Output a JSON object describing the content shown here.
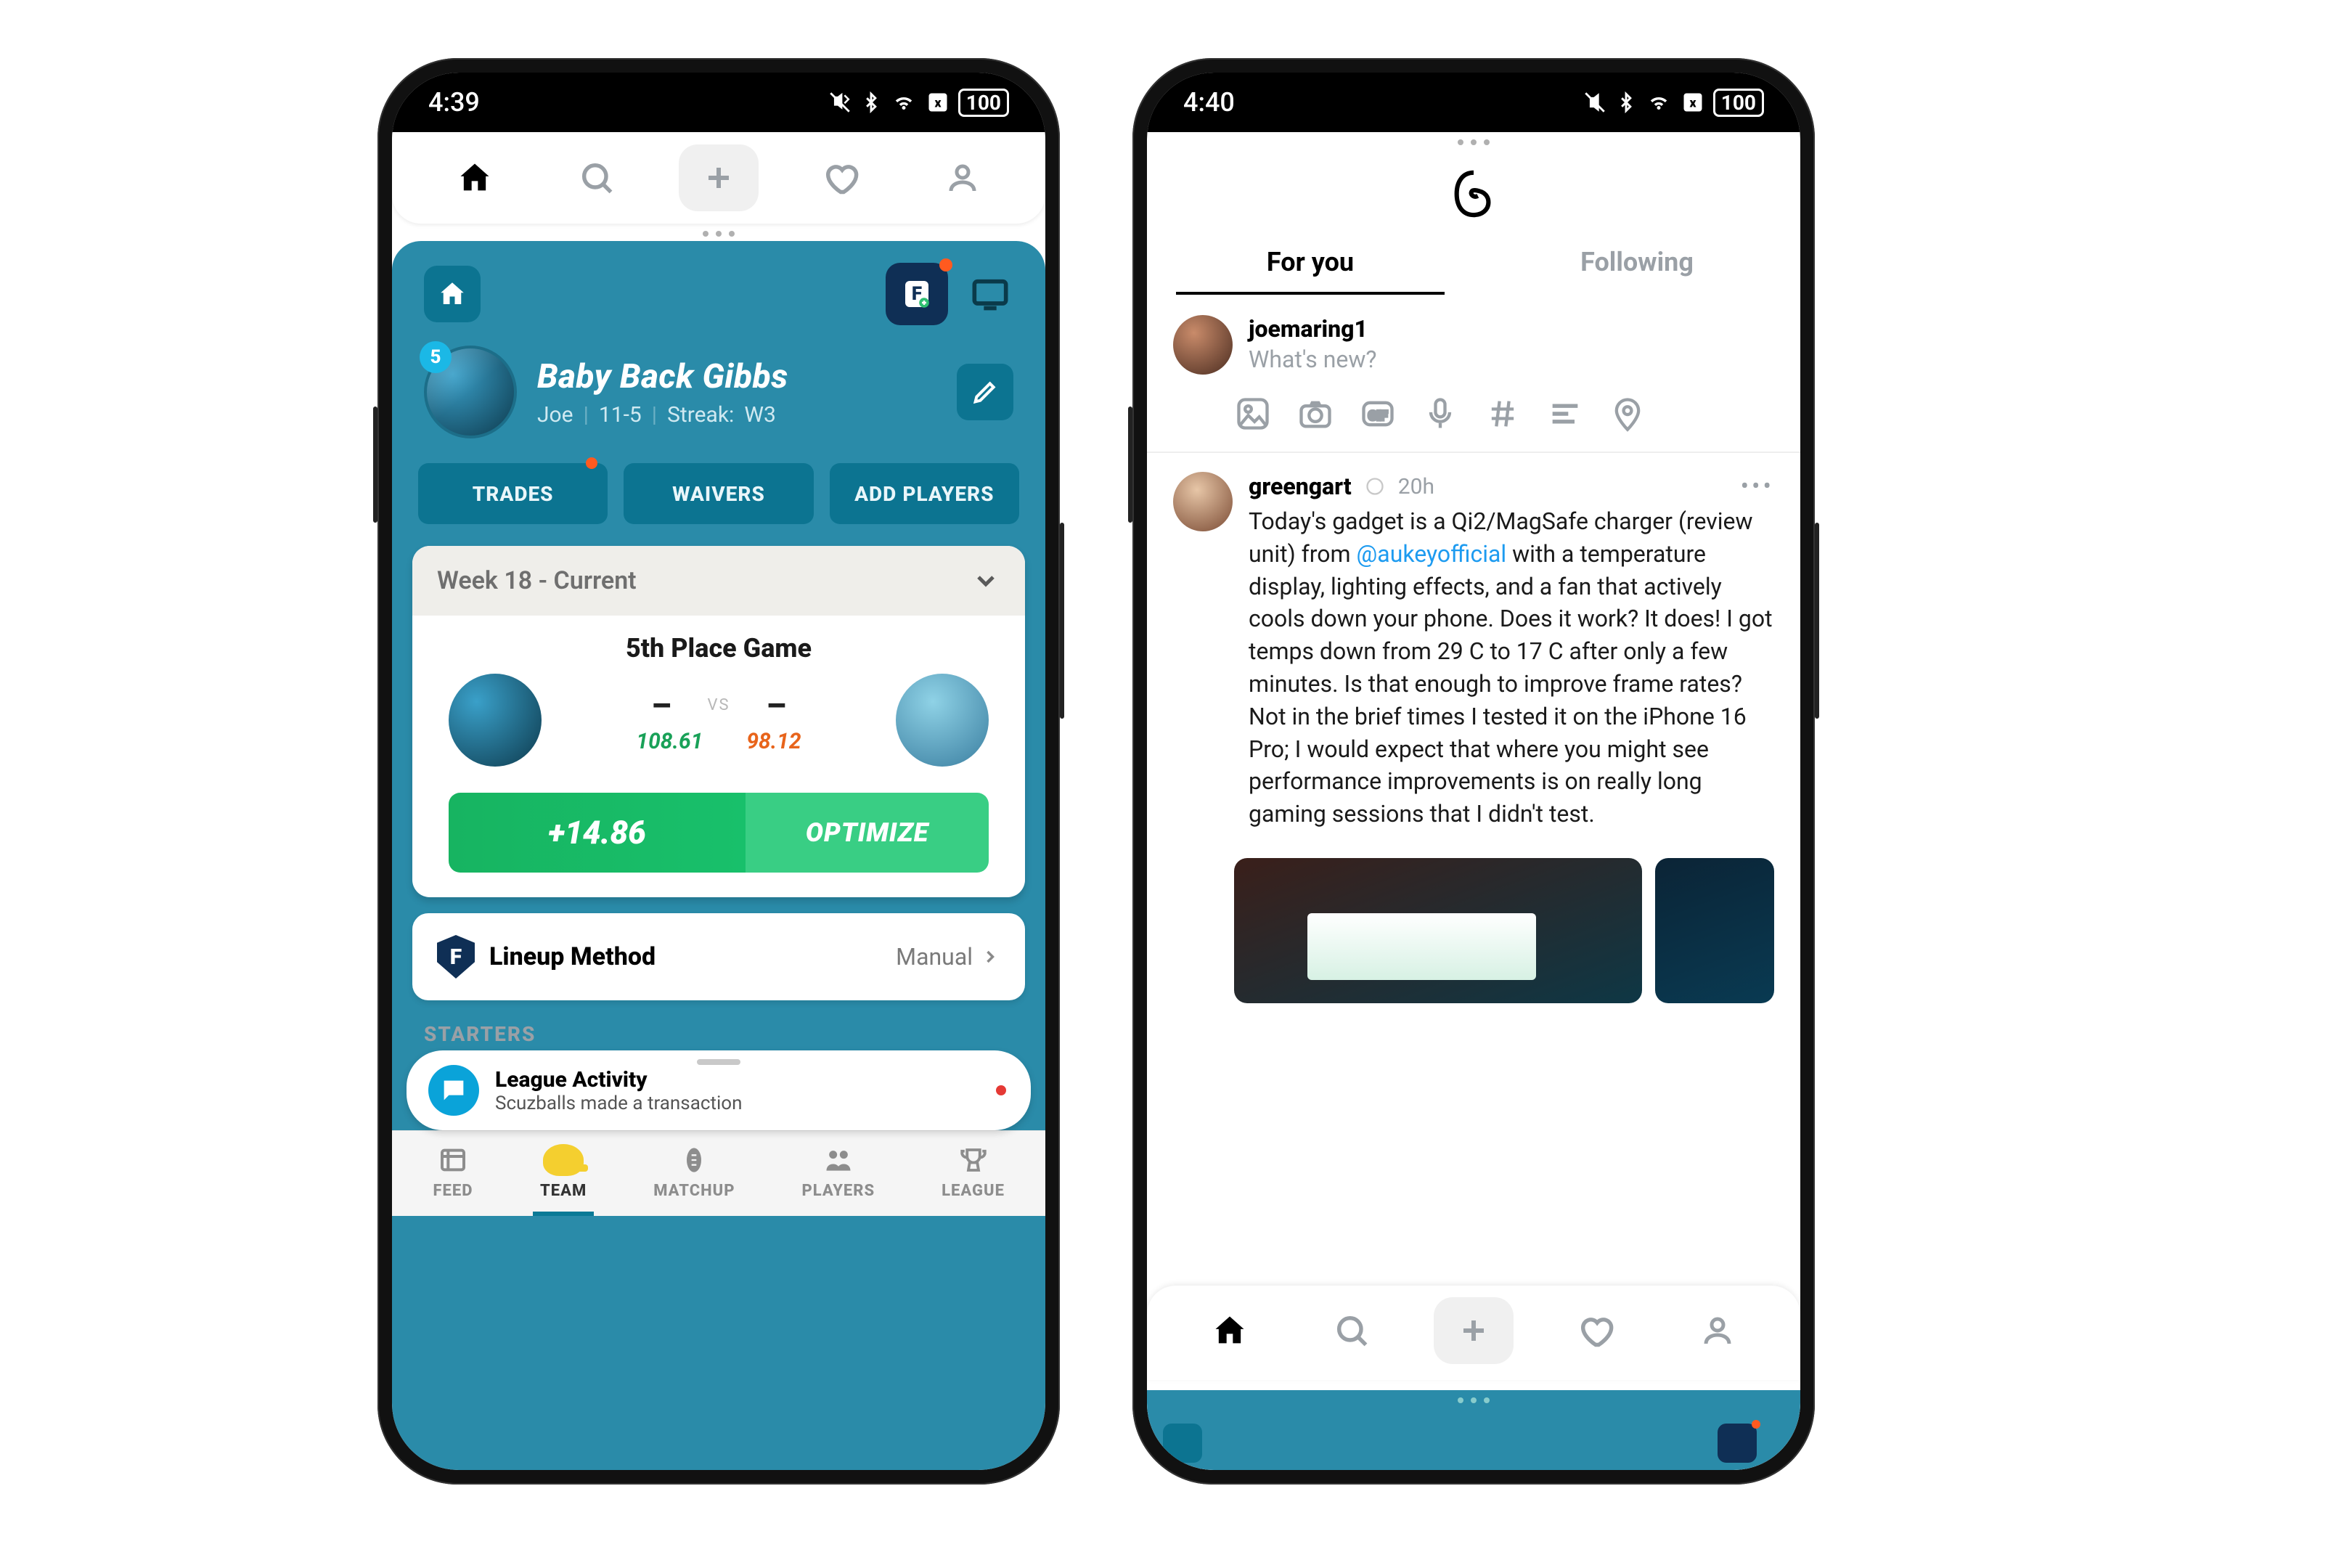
{
  "left": {
    "status": {
      "time": "4:39",
      "battery": "100"
    },
    "team": {
      "rank": "5",
      "name": "Baby Back Gibbs",
      "owner": "Joe",
      "record": "11-5",
      "streak_label": "Streak:",
      "streak": "W3"
    },
    "pills": {
      "trades": "TRADES",
      "waivers": "WAIVERS",
      "add": "ADD PLAYERS"
    },
    "weekbar": "Week 18 - Current",
    "match": {
      "title": "5th Place Game",
      "dash": "–",
      "vs": "VS",
      "proj_left": "108.61",
      "proj_right": "98.12",
      "delta": "+14.86",
      "optimize": "OPTIMIZE"
    },
    "lineup": {
      "label": "Lineup Method",
      "value": "Manual"
    },
    "starters": "STARTERS",
    "toast": {
      "title": "League Activity",
      "sub": "Scuzballs made a transaction"
    },
    "bottom": {
      "feed": "FEED",
      "team": "TEAM",
      "matchup": "MATCHUP",
      "players": "PLAYERS",
      "league": "LEAGUE"
    }
  },
  "right": {
    "status": {
      "time": "4:40",
      "battery": "100"
    },
    "tabs": {
      "foryou": "For you",
      "following": "Following"
    },
    "compose": {
      "user": "joemaring1",
      "placeholder": "What's new?"
    },
    "post": {
      "user": "greengart",
      "time": "20h",
      "body_pre": "Today's gadget is a Qi2/MagSafe charger (review unit) from ",
      "mention": "@aukeyofficial",
      "body_post": "  with a temperature display, lighting effects, and a fan that actively cools down your phone. Does it work? It does! I got temps down from 29 C to 17 C after only a few minutes. Is that enough to improve frame rates? Not in the brief times I tested it on the iPhone 16 Pro; I would expect that where you might see performance improvements is on really long gaming sessions that I didn't test."
    }
  }
}
